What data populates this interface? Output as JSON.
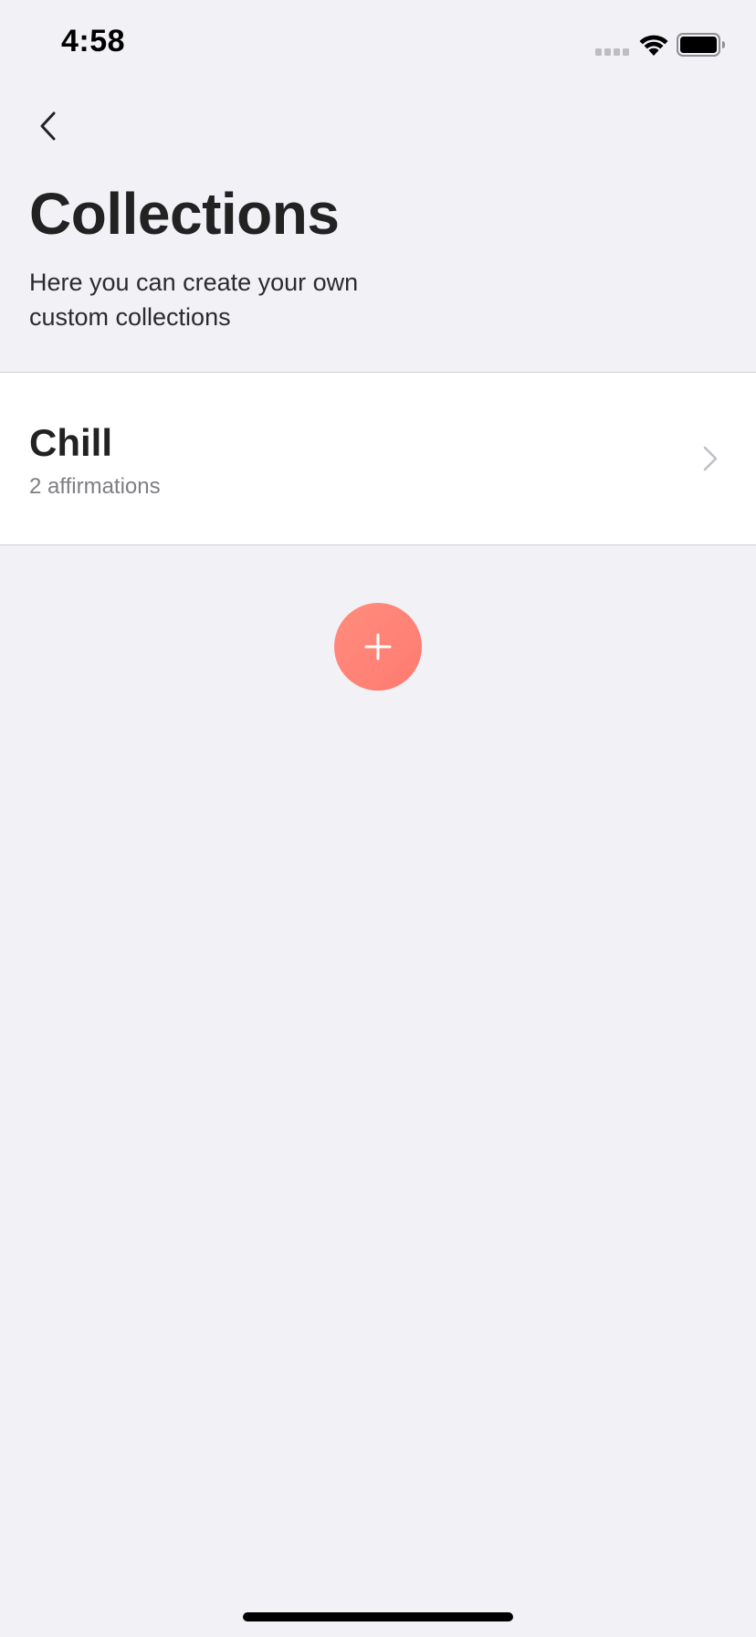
{
  "status_bar": {
    "time": "4:58",
    "icons": [
      "signal-icon",
      "wifi-icon",
      "battery-icon"
    ]
  },
  "nav": {
    "back_icon": "chevron-left-icon"
  },
  "header": {
    "title": "Collections",
    "subtitle": "Here you can create your own custom collections"
  },
  "collections": [
    {
      "name": "Chill",
      "count_label": "2 affirmations",
      "icon": "chevron-right-icon"
    }
  ],
  "add_button": {
    "icon": "plus-icon"
  },
  "colors": {
    "background": "#F2F1F6",
    "card": "#FFFFFF",
    "accent": "#FF8476",
    "title_text": "#222222",
    "secondary_text": "#7E7E83"
  }
}
